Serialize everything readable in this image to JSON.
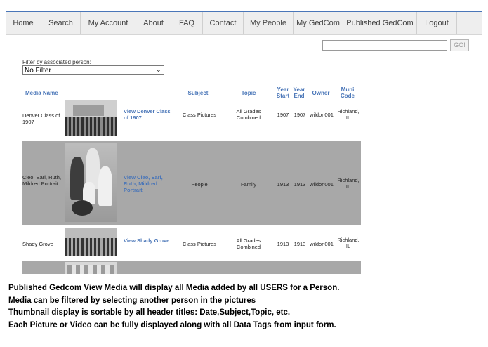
{
  "nav": {
    "items": [
      {
        "label": "Home"
      },
      {
        "label": "Search"
      },
      {
        "label": "My Account"
      },
      {
        "label": "About"
      },
      {
        "label": "FAQ"
      },
      {
        "label": "Contact"
      },
      {
        "label": "My People"
      },
      {
        "label": "My GedCom"
      },
      {
        "label": "Published GedCom"
      },
      {
        "label": "Logout"
      }
    ]
  },
  "search": {
    "value": "",
    "go_label": "GO!"
  },
  "filter": {
    "label": "Filter by associated person:",
    "selected": "No Filter"
  },
  "table": {
    "headers": {
      "media_name": "Media Name",
      "subject": "Subject",
      "topic": "Topic",
      "year_start": "Year Start",
      "year_end": "Year End",
      "owner": "Owner",
      "muni_code": "Muni Code"
    },
    "rows": [
      {
        "name": "Denver Class of 1907",
        "link": "View Denver Class of 1907",
        "subject": "Class Pictures",
        "topic": "All Grades Combined",
        "year_start": "1907",
        "year_end": "1907",
        "owner": "wildon001",
        "muni": "Richland, IL"
      },
      {
        "name": "Cleo, Earl, Ruth, Mildred Portrait",
        "link": "View Cleo, Earl, Ruth, Mildred Portrait",
        "subject": "People",
        "topic": "Family",
        "year_start": "1913",
        "year_end": "1913",
        "owner": "wildon001",
        "muni": "Richland, IL"
      },
      {
        "name": "Shady Grove",
        "link": "View Shady Grove",
        "subject": "Class Pictures",
        "topic": "All Grades Combined",
        "year_start": "1913",
        "year_end": "1913",
        "owner": "wildon001",
        "muni": "Richland, IL"
      }
    ]
  },
  "caption": {
    "lines": [
      "Published Gedcom View Media will display all Media added by all USERS for a Person.",
      "Media can be filtered by selecting another person in the pictures",
      "Thumbnail display is sortable by all header titles: Date,Subject,Topic, etc.",
      "Each Picture or Video can be fully  displayed along with all Data Tags from input form."
    ]
  }
}
